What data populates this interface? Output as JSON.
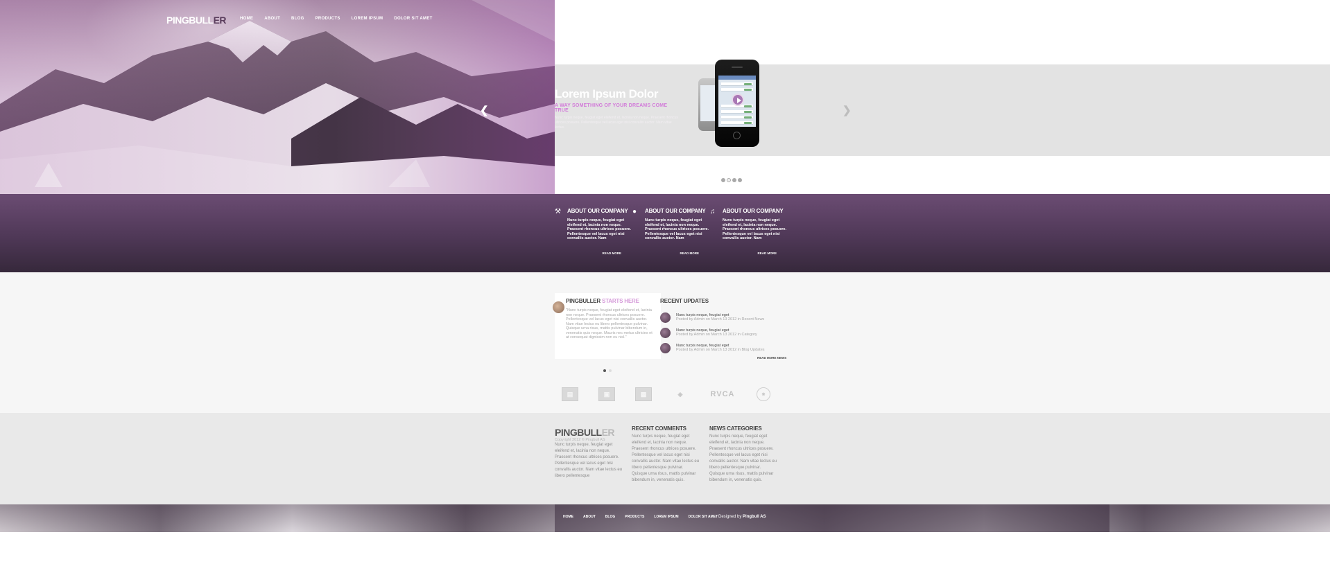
{
  "header": {
    "logo_main": "PINGBULL",
    "logo_accent": "ER",
    "nav": [
      "HOME",
      "ABOUT",
      "BLOG",
      "PRODUCTS",
      "LOREM IPSUM",
      "DOLOR SIT AMET"
    ]
  },
  "slider": {
    "title": "Lorem Ipsum Dolor",
    "subtitle": "A WAY SOMETHING OF YOUR DREAMS COME TRUE",
    "body": "Nunc turpis neque, feugiat eget eleifend et, lacinia non neque. Praesent rhoncus ultrices posuere. Pellentesque vel lacus eget nisi convallis auctor. Nam vitae lectus.",
    "prev_icon": "chevron-left-icon",
    "next_icon": "chevron-right-icon",
    "dot_count": 4,
    "active_dot": 1
  },
  "features": [
    {
      "icon": "wrench-icon",
      "glyph": "⚒",
      "title": "ABOUT OUR COMPANY",
      "body": "Nunc turpis neque, feugiat eget eleifend et, lacinia non neque. Praesent rhoncus ultrices posuere. Pellentesque vel lacus eget nisi convallis auctor. Nam",
      "more": "READ MORE"
    },
    {
      "icon": "chat-bubble-icon",
      "glyph": "●",
      "title": "ABOUT OUR COMPANY",
      "body": "Nunc turpis neque, feugiat eget eleifend et, lacinia non neque. Praesent rhoncus ultrices posuere. Pellentesque vel lacus eget nisi convallis auctor. Nam",
      "more": "READ MORE"
    },
    {
      "icon": "music-note-icon",
      "glyph": "♫",
      "title": "ABOUT OUR COMPANY",
      "body": "Nunc turpis neque, feugiat eget eleifend et, lacinia non neque. Praesent rhoncus ultrices posuere. Pellentesque vel lacus eget nisi convallis auctor. Nam",
      "more": "READ MORE"
    }
  ],
  "testimonial": {
    "title": "PINGBULLER",
    "title_accent": "STARTS HERE",
    "text": "\"Nunc turpis neque, feugiat eget eleifend et, lacinia non neque. Praesent rhoncus ultrices posuere. Pellentesque vel lacus eget nisi convallis auctor. Nam vitae lectus eu libero pellentesque pulvinar. Quisque urna risus, mattis pulvinar bibendum in, venenatis quis neque. Mauris nec metus ultricies et at consequat dignissim non eu nisl.\""
  },
  "updates": {
    "title": "RECENT UPDATES",
    "items": [
      {
        "title": "Nunc turpis neque, feugiat eget",
        "meta": "Posted by Admin on March 13 2012 in Recent News"
      },
      {
        "title": "Nunc turpis neque, feugiat eget",
        "meta": "Posted by Admin on March 13 2012 in Category"
      },
      {
        "title": "Nunc turpis neque, feugiat eget",
        "meta": "Posted by Admin on March 13 2012 in Blog Updates"
      }
    ],
    "more": "READ MORE NEWS"
  },
  "brands": [
    "brand-logo-1",
    "brand-logo-2",
    "brand-logo-3",
    "brand-logo-4",
    "RVCA",
    "brand-logo-6"
  ],
  "footer": {
    "logo_main": "PINGBULL",
    "logo_accent": "ER",
    "copyright": "Copyright 2012 © Pingbull AS",
    "about_text": "Nunc turpis neque, feugiat eget eleifend et, lacinia non neque. Praesent rhoncus ultrices posuere. Pellentesque vel lacus eget nisi convallis auctor. Nam vitae lectus eu libero pellentesque",
    "comments_title": "RECENT COMMENTS",
    "comments_text": "Nunc turpis neque, feugiat eget eleifend et, lacinia non neque. Praesent rhoncus ultrices posuere. Pellentesque vel lacus eget nisi convallis auctor. Nam vitae lectus eu libero pellentesque pulvinar. Quisque urna risus, mattis pulvinar bibendum in, venenatis quis.",
    "categories_title": "NEWS CATEGORIES",
    "categories_text": "Nunc turpis neque, feugiat eget eleifend et, lacinia non neque. Praesent rhoncus ultrices posuere. Pellentesque vel lacus eget nisi convallis auctor. Nam vitae lectus eu libero pellentesque pulvinar. Quisque urna risus, mattis pulvinar bibendum in, venenatis quis."
  },
  "bottom_nav": [
    "HOME",
    "ABOUT",
    "BLOG",
    "PRODUCTS",
    "LOREM IPSUM",
    "DOLOR SIT AMET"
  ],
  "credit": {
    "prefix": "Designed by",
    "name": "Pingbull AS"
  },
  "colors": {
    "accent": "#d59ad9",
    "purple_dark": "#36283b",
    "purple_light": "#6b4c73"
  }
}
